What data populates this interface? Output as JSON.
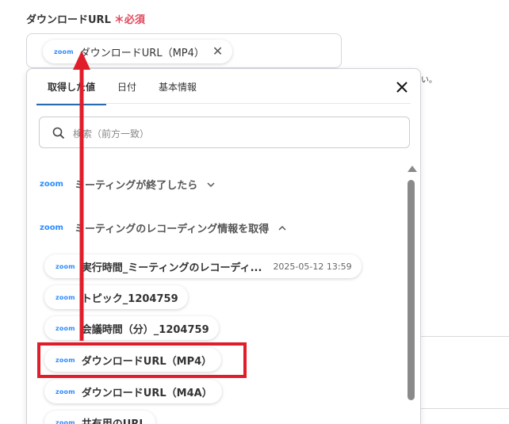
{
  "field": {
    "label": "ダウンロードURL",
    "required_mark": "＊必須",
    "chip_logo": "zoom",
    "chip_text": "ダウンロードURL（MP4）",
    "chip_remove": "✕"
  },
  "background": {
    "hint_fragment": "い。"
  },
  "panel": {
    "tabs": [
      {
        "label": "取得した値",
        "active": true
      },
      {
        "label": "日付",
        "active": false
      },
      {
        "label": "基本情報",
        "active": false
      }
    ],
    "search_placeholder": "検索（前方一致）",
    "sections": [
      {
        "logo": "zoom",
        "label": "ミーティングが終了したら",
        "expanded": false
      },
      {
        "logo": "zoom",
        "label": "ミーティングのレコーディング情報を取得",
        "expanded": true
      }
    ],
    "items": [
      {
        "logo": "zoom",
        "label": "実行時間_ミーティングのレコーディ...",
        "value": "2025-05-12 13:59"
      },
      {
        "logo": "zoom",
        "label": "トピック_1204759"
      },
      {
        "logo": "zoom",
        "label": "会議時間（分）_1204759"
      },
      {
        "logo": "zoom",
        "label": "ダウンロードURL（MP4）",
        "highlighted": true
      },
      {
        "logo": "zoom",
        "label": "ダウンロードURL（M4A）"
      },
      {
        "logo": "zoom",
        "label": "共有用のURL"
      }
    ]
  },
  "colors": {
    "zoom_blue": "#2d8cff",
    "required_red": "#e0475a",
    "annotation_red": "#e01e2b",
    "active_tab_underline": "#2b6cb0"
  }
}
